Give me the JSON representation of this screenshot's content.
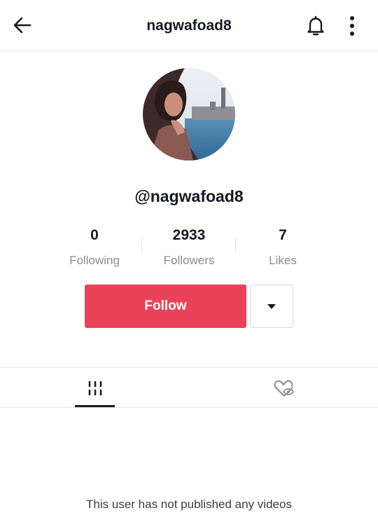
{
  "header": {
    "title": "nagwafoad8",
    "back_icon": "arrow-left-icon",
    "bell_icon": "bell-icon",
    "more_icon": "more-vertical-icon"
  },
  "profile": {
    "handle": "@nagwafoad8",
    "avatar": "profile-photo"
  },
  "stats": [
    {
      "value": "0",
      "label": "Following"
    },
    {
      "value": "2933",
      "label": "Followers"
    },
    {
      "value": "7",
      "label": "Likes"
    }
  ],
  "actions": {
    "follow_label": "Follow",
    "follow_color": "#ea4359",
    "dropdown_icon": "caret-down-icon"
  },
  "tabs": [
    {
      "icon": "videos-grid-icon",
      "active": true
    },
    {
      "icon": "liked-private-icon",
      "active": false
    }
  ],
  "empty_state": {
    "message": "This user has not published any videos"
  }
}
